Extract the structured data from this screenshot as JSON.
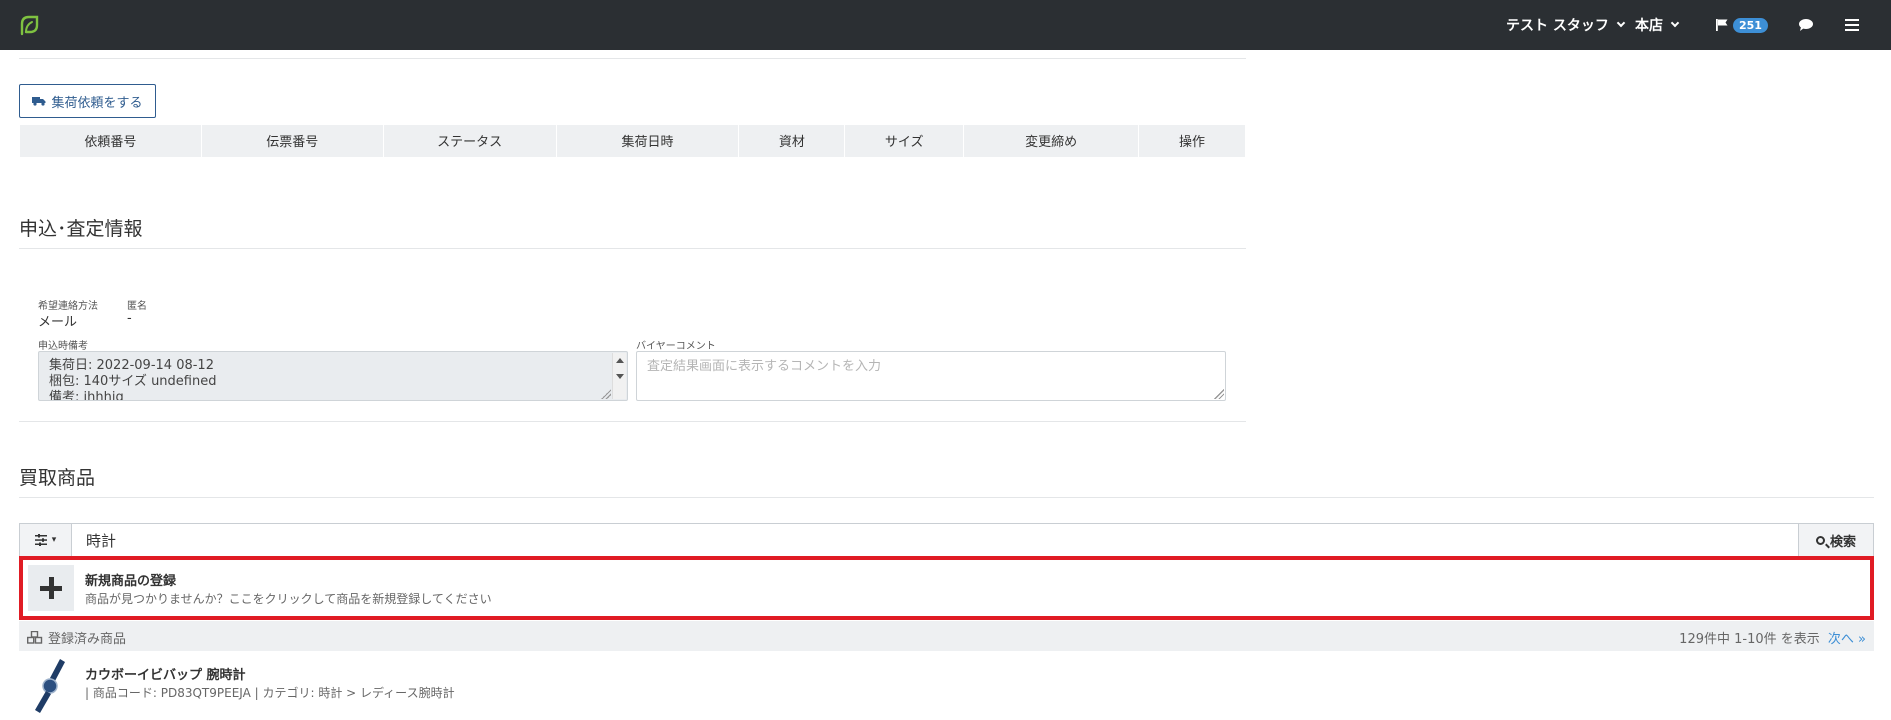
{
  "navbar": {
    "logo_icon": "leaf-logo-icon",
    "user_label": "テスト スタッフ",
    "store_label": "本店",
    "flag_count": "251",
    "icons": [
      "flag-icon",
      "chat-icon",
      "menu-icon"
    ]
  },
  "pickup": {
    "button_label": "集荷依頼をする",
    "columns": [
      "依頼番号",
      "伝票番号",
      "ステータス",
      "集荷日時",
      "資材",
      "サイズ",
      "変更締め",
      "操作"
    ]
  },
  "application": {
    "title": "申込･査定情報",
    "contact_label": "希望連絡方法",
    "contact_value": "メール",
    "anonymous_label": "匿名",
    "anonymous_value": "-",
    "memo_label": "申込時備考",
    "memo_lines": [
      "集荷日: 2022-09-14 08-12",
      "梱包: 140サイズ undefined",
      "備考: jhhhjg"
    ],
    "buyer_comment_label": "バイヤーコメント",
    "buyer_comment_placeholder": "査定結果画面に表示するコメントを入力"
  },
  "purchase": {
    "title": "買取商品",
    "search_value": "時計",
    "search_button": "検索",
    "new_item_title": "新規商品の登録",
    "new_item_sub": "商品が見つかりませんか？ここをクリックして商品を新規登録してください",
    "registered_label": "登録済み商品",
    "count_text": "129件中 1-10件 を表示",
    "next_label": "次へ »",
    "products": [
      {
        "name": "カウボーイビバップ 腕時計",
        "meta": "| 商品コード: PD83QT9PEEJA | カテゴリ: 時計 > レディース腕時計"
      }
    ]
  },
  "colors": {
    "navbar": "#2b2f33",
    "accent": "#3d8fd6",
    "highlight": "#e01b24",
    "logo": "#7fc241"
  }
}
